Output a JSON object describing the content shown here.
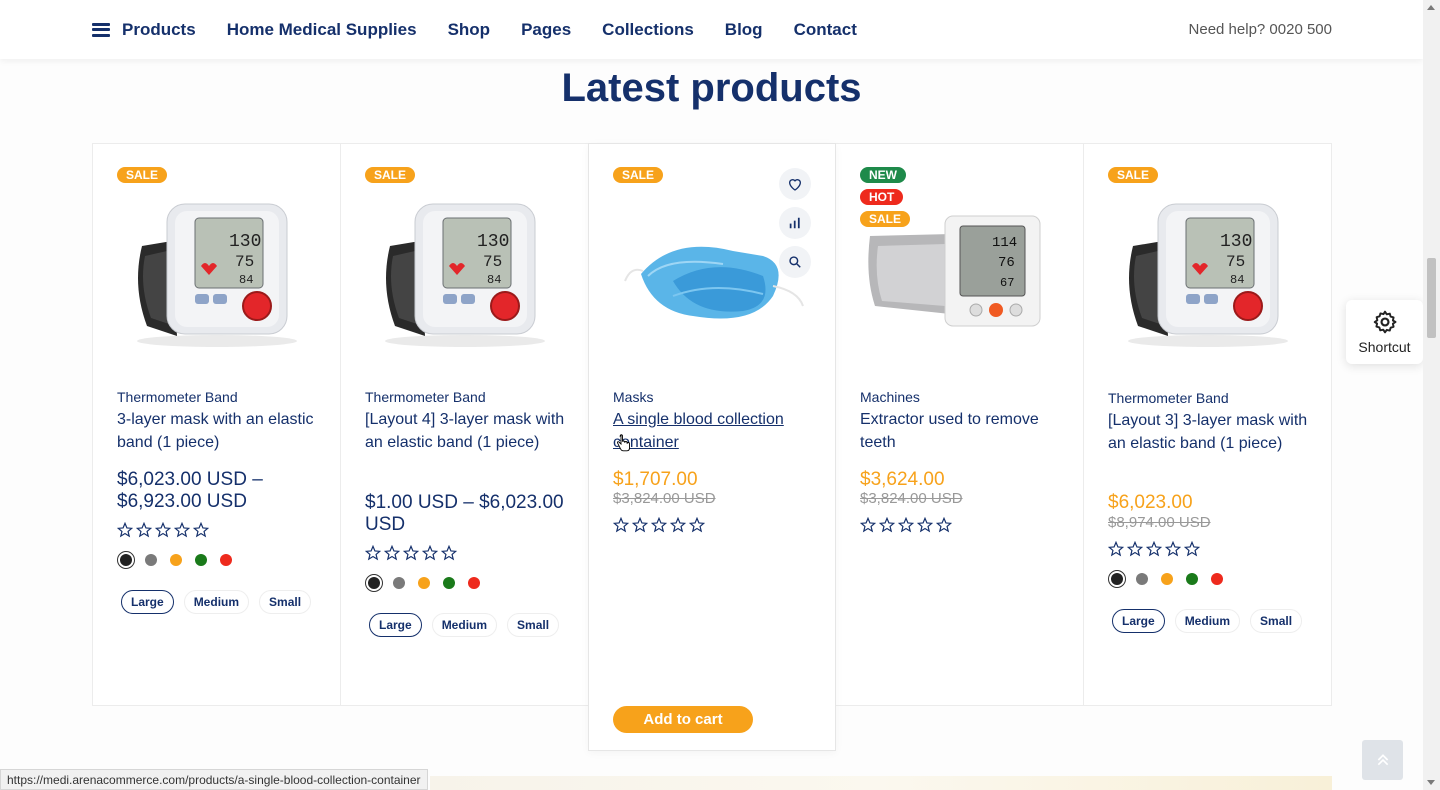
{
  "nav": {
    "items": [
      "Products",
      "Home Medical Supplies",
      "Shop",
      "Pages",
      "Collections",
      "Blog",
      "Contact"
    ],
    "help": "Need help? 0020 500"
  },
  "section_title": "Latest products",
  "products": [
    {
      "badges": [
        "SALE"
      ],
      "image": "blood-pressure-monitor-wrist",
      "category": "Thermometer Band",
      "title": "3-layer mask with an elastic band (1 piece)",
      "price": "$6,023.00 USD – $6,923.00 USD",
      "colors": [
        "#222222",
        "#7a7a7a",
        "#f7a21b",
        "#1a7a1a",
        "#ee2a1d"
      ],
      "sizes": [
        "Large",
        "Medium",
        "Small"
      ]
    },
    {
      "badges": [
        "SALE"
      ],
      "image": "blood-pressure-monitor-wrist",
      "category": "Thermometer Band",
      "title": "[Layout 4] 3-layer mask with an elastic band (1 piece)",
      "price": "$1.00 USD – $6,023.00 USD",
      "colors": [
        "#222222",
        "#7a7a7a",
        "#f7a21b",
        "#1a7a1a",
        "#ee2a1d"
      ],
      "sizes": [
        "Large",
        "Medium",
        "Small"
      ]
    },
    {
      "badges": [
        "SALE"
      ],
      "image": "surgical-masks",
      "category": "Masks",
      "title": "A single blood collection container",
      "price": "$1,707.00",
      "old_price": "$3,824.00 USD",
      "add_to_cart": "Add to cart"
    },
    {
      "badges": [
        "NEW",
        "HOT",
        "SALE"
      ],
      "image": "blood-pressure-monitor-arm",
      "category": "Machines",
      "title": "Extractor used to remove teeth",
      "price": "$3,624.00",
      "old_price": "$3,824.00 USD"
    },
    {
      "badges": [
        "SALE"
      ],
      "image": "blood-pressure-monitor-wrist",
      "category": "Thermometer Band",
      "title": "[Layout 3] 3-layer mask with an elastic band (1 piece)",
      "price": "$6,023.00",
      "old_price": "$8,974.00 USD",
      "colors": [
        "#222222",
        "#7a7a7a",
        "#f7a21b",
        "#1a7a1a",
        "#ee2a1d"
      ],
      "sizes": [
        "Large",
        "Medium",
        "Small"
      ]
    }
  ],
  "shortcut_label": "Shortcut",
  "status_url": "https://medi.arenacommerce.com/products/a-single-blood-collection-container",
  "icons": [
    "menu-icon",
    "heart-icon",
    "compare-icon",
    "search-icon",
    "gear-icon",
    "chevron-up-icon",
    "star-icon"
  ]
}
